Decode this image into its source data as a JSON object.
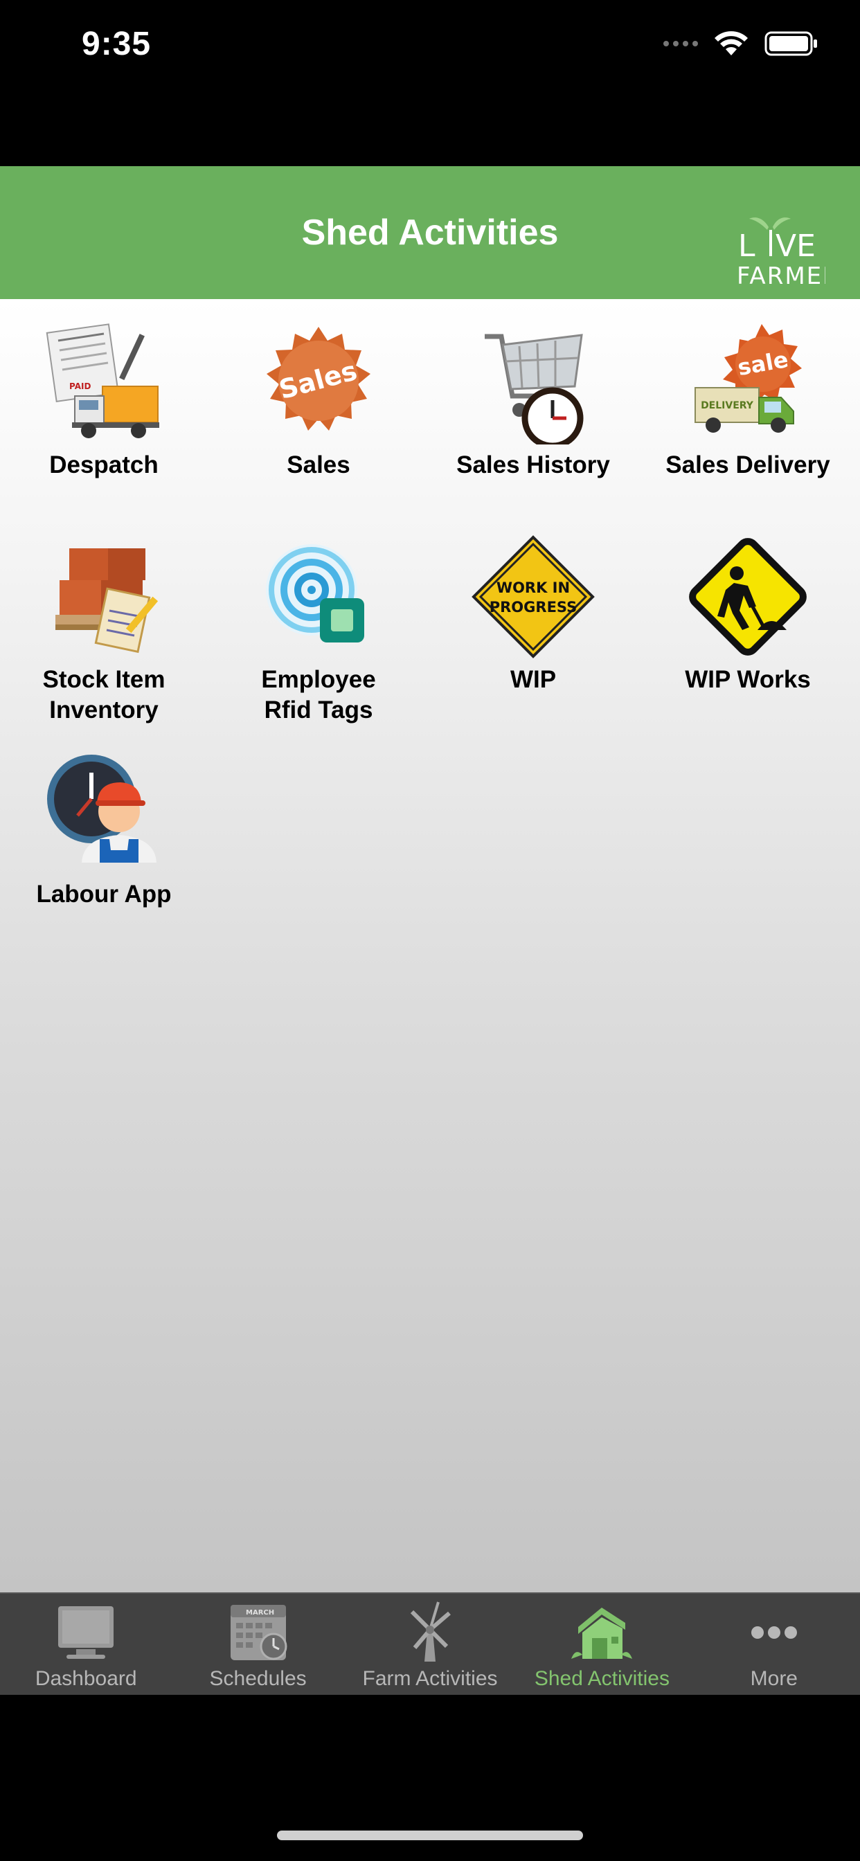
{
  "status": {
    "time": "9:35"
  },
  "header": {
    "title": "Shed Activities",
    "logo_text": "LIVE FARMER"
  },
  "tiles": [
    {
      "label": "Despatch",
      "icon": "despatch-truck-icon"
    },
    {
      "label": "Sales",
      "icon": "sales-badge-icon"
    },
    {
      "label": "Sales History",
      "icon": "cart-clock-icon"
    },
    {
      "label": "Sales Delivery",
      "icon": "delivery-truck-icon"
    },
    {
      "label": "Stock Item\nInventory",
      "label_line1": "Stock Item",
      "label_line2": "Inventory",
      "icon": "boxes-clipboard-icon"
    },
    {
      "label_line1": "Employee",
      "label_line2": "Rfid Tags",
      "icon": "rfid-icon"
    },
    {
      "label": "WIP",
      "sign_text_1": "WORK IN",
      "sign_text_2": "PROGRESS",
      "icon": "work-in-progress-sign-icon"
    },
    {
      "label": "WIP Works",
      "icon": "men-at-work-sign-icon"
    },
    {
      "label": "Labour App",
      "icon": "worker-clock-icon"
    }
  ],
  "tiles_misc": {
    "sales_badge_text": "Sales",
    "sale_badge_text": "sale",
    "delivery_text": "DELIVERY",
    "paid_text": "PAID"
  },
  "tabs": [
    {
      "label": "Dashboard",
      "icon": "monitor-icon",
      "active": false
    },
    {
      "label": "Schedules",
      "icon": "calendar-icon",
      "month": "MARCH",
      "active": false
    },
    {
      "label": "Farm Activities",
      "icon": "windmill-icon",
      "active": false
    },
    {
      "label": "Shed Activities",
      "icon": "shed-icon",
      "active": true
    },
    {
      "label": "More",
      "icon": "more-dots-icon",
      "active": false
    }
  ],
  "colors": {
    "header": "#6ab05d",
    "tab_active": "#83c46e",
    "tab_inactive": "#b7b7b7",
    "tab_bar": "#414141"
  }
}
